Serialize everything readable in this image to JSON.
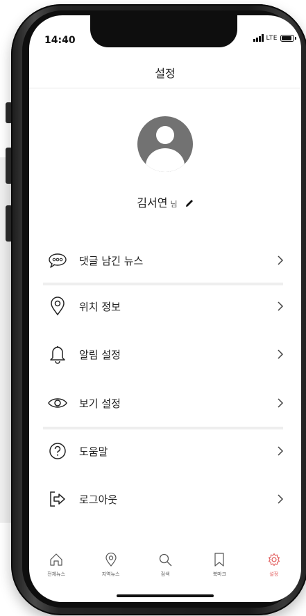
{
  "status": {
    "time": "14:40",
    "network": "LTE"
  },
  "header": {
    "title": "설정"
  },
  "profile": {
    "name": "김서연",
    "suffix": "님"
  },
  "menu": [
    {
      "label": "댓글 남긴 뉴스",
      "icon": "chat-bubble-icon"
    },
    {
      "label": "위치 정보",
      "icon": "location-pin-icon"
    },
    {
      "label": "알림 설정",
      "icon": "bell-icon"
    },
    {
      "label": "보기 설정",
      "icon": "eye-icon"
    },
    {
      "label": "도움말",
      "icon": "help-circle-icon"
    },
    {
      "label": "로그아웃",
      "icon": "logout-icon"
    }
  ],
  "tabs": [
    {
      "label": "전체뉴스",
      "icon": "home-icon",
      "active": false
    },
    {
      "label": "지역뉴스",
      "icon": "location-pin-icon",
      "active": false
    },
    {
      "label": "검색",
      "icon": "search-icon",
      "active": false
    },
    {
      "label": "북마크",
      "icon": "bookmark-icon",
      "active": false
    },
    {
      "label": "설정",
      "icon": "gear-icon",
      "active": true
    }
  ],
  "colors": {
    "accent": "#e05555",
    "text": "#222222",
    "avatar": "#727272"
  }
}
